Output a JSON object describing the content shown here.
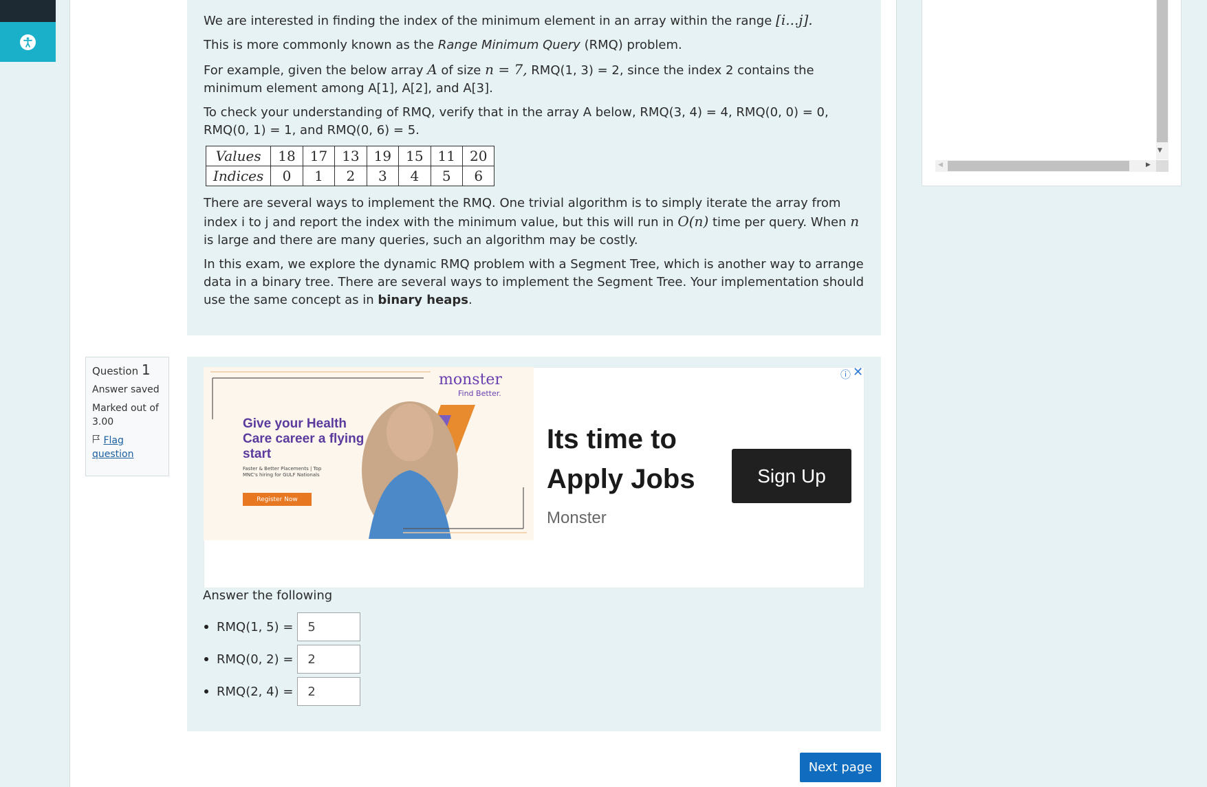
{
  "question_text": {
    "p1": "We are interested in finding the index of the minimum element in an array within the range",
    "p1_math": "[i...j].",
    "p2_pre": "This is more commonly known as the",
    "p2_em": "Range Minimum Query",
    "p2_post": "(RMQ) problem.",
    "p3_pre": "For example, given the below array",
    "p3_math1": "A",
    "p3_mid": "of size",
    "p3_math2": "n = 7,",
    "p3_post": "RMQ(1, 3) = 2, since the index 2 contains the minimum element among A[1], A[2], and A[3].",
    "p4": "To check your understanding of RMQ, verify that in the array A below, RMQ(3, 4) = 4, RMQ(0, 0) = 0, RMQ(0, 1) = 1, and RMQ(0, 6) = 5.",
    "table": {
      "row1_header": "Values",
      "row2_header": "Indices",
      "values": [
        "18",
        "17",
        "13",
        "19",
        "15",
        "11",
        "20"
      ],
      "indices": [
        "0",
        "1",
        "2",
        "3",
        "4",
        "5",
        "6"
      ]
    },
    "p5_a": "There are several ways to implement the RMQ. One trivial algorithm is to simply iterate the array from index i to j and report the index with the minimum value, but this will run in",
    "p5_math1": "O(n)",
    "p5_b": "time per query. When",
    "p5_math2": "n",
    "p5_c": "is large and there are many queries, such an algorithm may be costly.",
    "p6_a": "In this exam, we explore the dynamic RMQ problem with a Segment Tree, which is another way to arrange data in a binary tree. There are several ways to implement the Segment Tree. Your implementation should use the same concept as in",
    "p6_bold": "binary heaps",
    "p6_end": "."
  },
  "question_info": {
    "label": "Question",
    "number": "1",
    "status": "Answer saved",
    "marked": "Marked out of 3.00",
    "flag": "Flag question"
  },
  "ad": {
    "brand": "monster",
    "brand_tag": "Find Better.",
    "img_headline": "Give your Health Care career a flying start",
    "img_sub": "Faster & Better Placements | Top MNC's hiring for GULF Nationals",
    "img_cta": "Register Now",
    "headline": "Its time to Apply Jobs",
    "advertiser": "Monster",
    "cta": "Sign Up",
    "info_glyph": "ⓘ",
    "close_glyph": "✕"
  },
  "answers": {
    "prompt": "Answer the following",
    "items": [
      {
        "label": "RMQ(1, 5) =",
        "value": "5"
      },
      {
        "label": "RMQ(0, 2) =",
        "value": "2"
      },
      {
        "label": "RMQ(2, 4) =",
        "value": "2"
      }
    ]
  },
  "nav": {
    "next_label": "Next page"
  },
  "colors": {
    "accent": "#0f6cbf",
    "a11y": "#1bb0c9",
    "panel_bg": "#e7f2f4"
  }
}
